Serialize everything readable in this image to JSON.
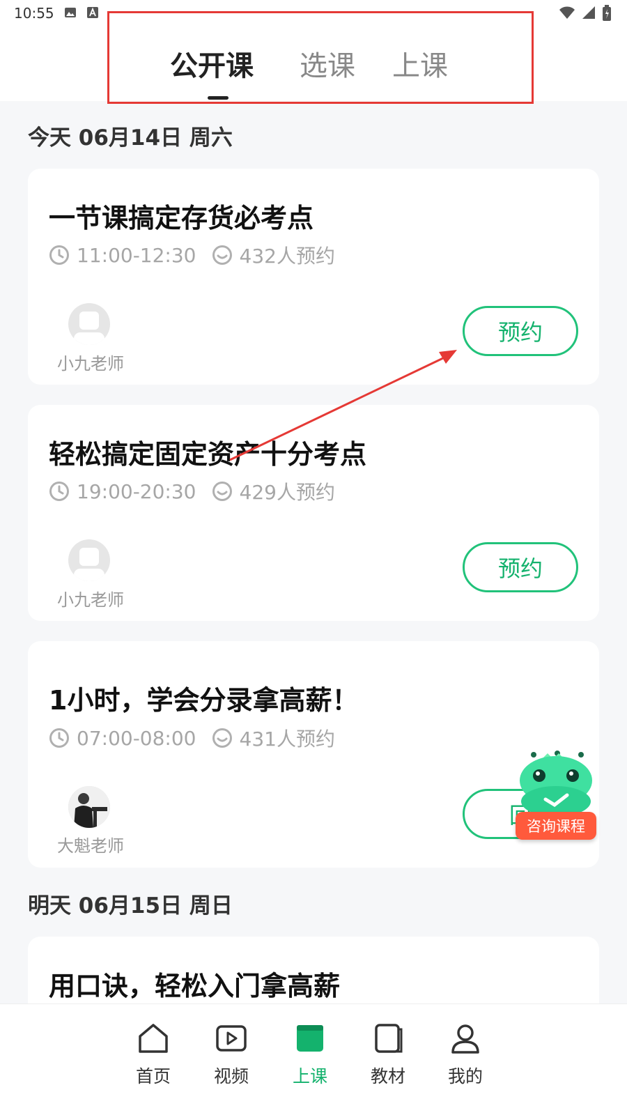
{
  "status_bar": {
    "time": "10:55"
  },
  "header": {
    "tabs": [
      {
        "label": "公开课"
      },
      {
        "label": "选课"
      },
      {
        "label": "上课"
      }
    ]
  },
  "sections": [
    {
      "date_label": "今天 06月14日 周六",
      "courses": [
        {
          "title": "一节课搞定存货必考点",
          "time": "11:00-12:30",
          "reservations": "432人预约",
          "teacher": "小九老师",
          "button": "预约"
        },
        {
          "title": "轻松搞定固定资产十分考点",
          "time": "19:00-20:30",
          "reservations": "429人预约",
          "teacher": "小九老师",
          "button": "预约"
        },
        {
          "title": "1小时，学会分录拿高薪！",
          "time": "07:00-08:00",
          "reservations": "431人预约",
          "teacher": "大魁老师",
          "button": "回"
        }
      ]
    },
    {
      "date_label": "明天 06月15日 周日",
      "courses": [
        {
          "title": "用口诀，轻松入门拿高薪"
        }
      ]
    }
  ],
  "floating": {
    "consult_label": "咨询课程"
  },
  "bottom_nav": {
    "items": [
      {
        "label": "首页",
        "icon": "home-icon"
      },
      {
        "label": "视频",
        "icon": "video-icon"
      },
      {
        "label": "上课",
        "icon": "class-icon"
      },
      {
        "label": "教材",
        "icon": "book-icon"
      },
      {
        "label": "我的",
        "icon": "user-icon"
      }
    ],
    "active_index": 2
  },
  "colors": {
    "accent": "#14b26d",
    "annotation": "#e53935",
    "consult": "#ff5a3c"
  }
}
